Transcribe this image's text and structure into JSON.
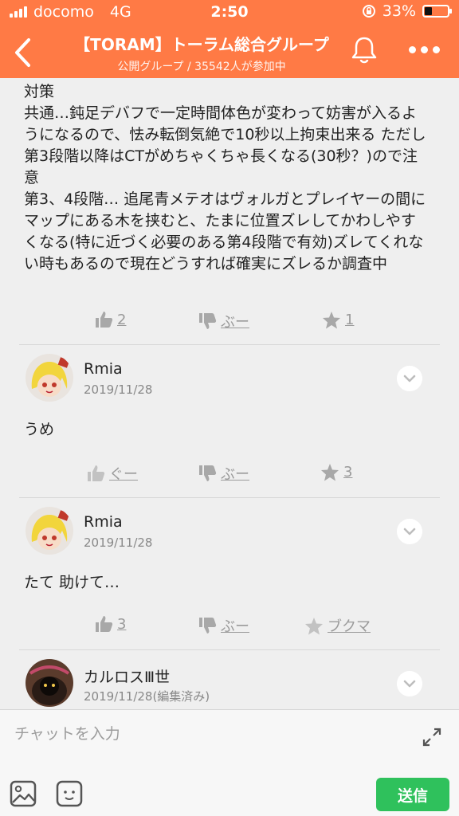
{
  "status_bar": {
    "carrier": "docomo",
    "network": "4G",
    "time": "2:50",
    "battery": "33%",
    "battery_level": 0.33
  },
  "header": {
    "title": "【TORAM】トーラム総合グループ",
    "subtitle": "公開グループ / 35542人が参加中"
  },
  "post": {
    "text": "対策\n共通…鈍足デバフで一定時間体色が変わって妨害が入るようになるので、怯み転倒気絶で10秒以上拘束出来る ただし第3段階以降はCTがめちゃくちゃ長くなる(30秒？)ので注意\n第3、4段階… 追尾青メテオはヴォルガとプレイヤーの間にマップにある木を挟むと、たまに位置ズレしてかわしやすくなる(特に近づく必要のある第4段階で有効)ズレてくれない時もあるので現在どうすれば確実にズレるか調査中",
    "like": "2",
    "dislike": "ぶー",
    "star": "1"
  },
  "comments": [
    {
      "name": "Rmia",
      "date": "2019/11/28",
      "text": "うめ",
      "like": "ぐー",
      "dislike": "ぶー",
      "star": "3"
    },
    {
      "name": "Rmia",
      "date": "2019/11/28",
      "text": "たて 助けて…",
      "like": "3",
      "dislike": "ぶー",
      "star": "ブクマ"
    },
    {
      "name": "カルロスⅢ世",
      "date": "2019/11/28(編集済み)"
    }
  ],
  "composer": {
    "placeholder": "チャットを入力",
    "send_label": "送信"
  },
  "colors": {
    "header": "#ff7a45",
    "send": "#2fc15c",
    "background": "#efefef"
  }
}
